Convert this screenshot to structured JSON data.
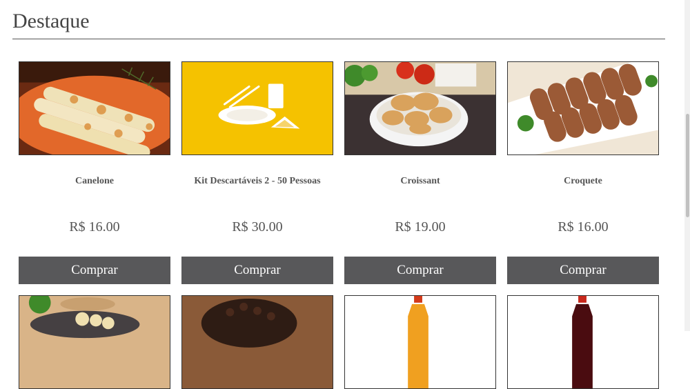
{
  "section": {
    "title": "Destaque"
  },
  "products": [
    {
      "name": "Canelone",
      "price": "R$ 16.00",
      "button": "Comprar",
      "image": "canelone-photo"
    },
    {
      "name": "Kit Descartáveis 2 - 50 Pessoas",
      "price": "R$ 30.00",
      "button": "Comprar",
      "image": "disposable-kit-icon"
    },
    {
      "name": "Croissant",
      "price": "R$ 19.00",
      "button": "Comprar",
      "image": "croissant-photo"
    },
    {
      "name": "Croquete",
      "price": "R$ 16.00",
      "button": "Comprar",
      "image": "croquete-photo"
    }
  ],
  "next_row_images": [
    "savory-platter-photo",
    "chocolate-cake-photo",
    "orange-soda-bottle-photo",
    "cola-bottle-photo"
  ]
}
